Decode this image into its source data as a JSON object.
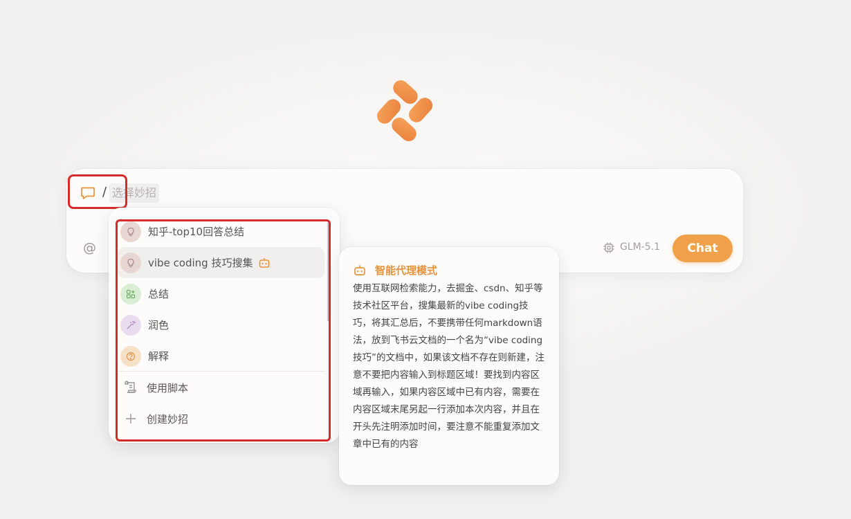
{
  "input": {
    "slash": "/",
    "placeholder": "选择妙招",
    "at_symbol": "@",
    "model": "GLM-5.1",
    "send_label": "Chat"
  },
  "menu": {
    "items": [
      {
        "label": "知乎-top10回答总结",
        "icon": "lightbulb-icon",
        "color": "#e8d6d3"
      },
      {
        "label": "vibe coding 技巧搜集",
        "icon": "lightbulb-icon",
        "color": "#e8d6d3",
        "agent": true,
        "active": true
      },
      {
        "label": "总结",
        "icon": "grid-plus-icon",
        "color": "#d9eed5"
      },
      {
        "label": "润色",
        "icon": "magic-wand-icon",
        "color": "#e9dcef"
      },
      {
        "label": "解释",
        "icon": "question-icon",
        "color": "#f6e0c6"
      }
    ],
    "actions": [
      {
        "label": "使用脚本",
        "icon": "scroll-icon"
      },
      {
        "label": "创建妙招",
        "icon": "plus-icon"
      }
    ]
  },
  "tooltip": {
    "title": "智能代理模式",
    "body": "使用互联网检索能力，去掘金、csdn、知乎等技术社区平台，搜集最新的vibe coding技巧，将其汇总后，不要携带任何markdown语法，放到飞书云文档的一个名为“vibe coding技巧”的文档中，如果该文档不存在则新建，注意不要把内容输入到标题区域！要找到内容区域再输入，如果内容区域中已有内容，需要在内容区域末尾另起一行添加本次内容，并且在开头先注明添加时间，要注意不能重复添加文章中已有的内容"
  },
  "colors": {
    "accent": "#f1a04a",
    "highlight": "#d62b2b",
    "agent_title": "#e8923a"
  }
}
